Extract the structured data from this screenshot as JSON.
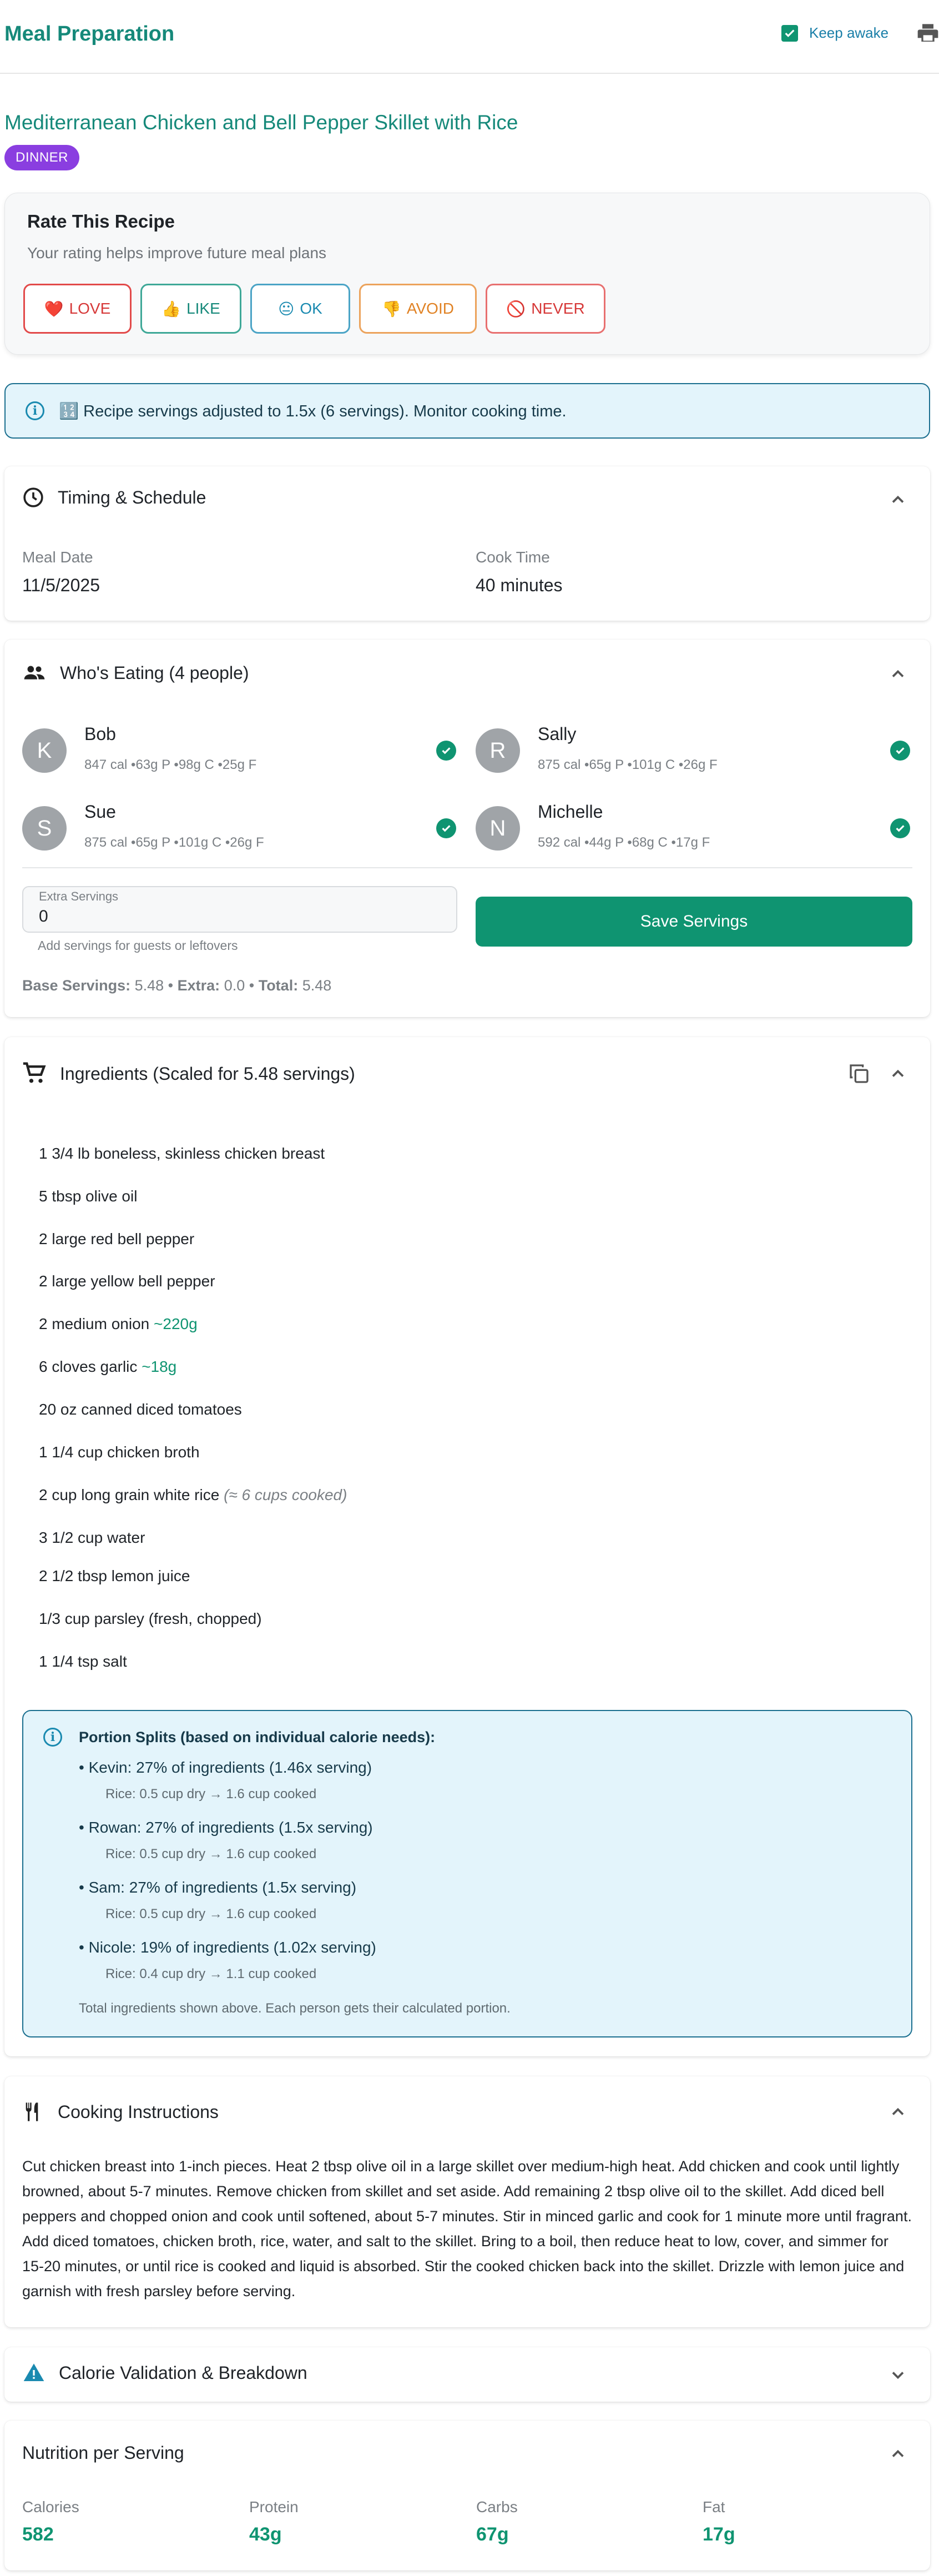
{
  "header": {
    "app_title": "Meal Preparation",
    "keep_awake_label": "Keep awake",
    "keep_awake_checked": true
  },
  "recipe": {
    "title": "Mediterranean Chicken and Bell Pepper Skillet with Rice",
    "meal_type_badge": "DINNER"
  },
  "rating": {
    "title": "Rate This Recipe",
    "subtitle": "Your rating helps improve future meal plans",
    "buttons": [
      {
        "label": "LOVE",
        "icon": "heart-icon",
        "emoji": "❤️",
        "color": "#e24a4a"
      },
      {
        "label": "LIKE",
        "icon": "thumbs-up-icon",
        "emoji": "👍",
        "color": "#16897a"
      },
      {
        "label": "OK",
        "icon": "neutral-face-icon",
        "emoji": "😐",
        "color": "#1a8ab0"
      },
      {
        "label": "AVOID",
        "icon": "thumbs-down-icon",
        "emoji": "👎",
        "color": "#e8892b"
      },
      {
        "label": "NEVER",
        "icon": "prohibited-icon",
        "emoji": "🚫",
        "color": "#e24a4a"
      }
    ]
  },
  "info_banner": {
    "icon": "info-icon",
    "text": "🔢 Recipe servings adjusted to 1.5x (6 servings). Monitor cooking time."
  },
  "timing": {
    "title": "Timing & Schedule",
    "meal_date_label": "Meal Date",
    "meal_date": "11/5/2025",
    "cook_time_label": "Cook Time",
    "cook_time": "40 minutes"
  },
  "eaters": {
    "title": "Who's Eating (4 people)",
    "people": [
      {
        "initial": "K",
        "name": "Bob",
        "macros": "847 cal •63g P •98g C •25g F"
      },
      {
        "initial": "R",
        "name": "Sally",
        "macros": "875 cal •65g P •101g C •26g F"
      },
      {
        "initial": "S",
        "name": "Sue",
        "macros": "875 cal •65g P •101g C •26g F"
      },
      {
        "initial": "N",
        "name": "Michelle",
        "macros": "592 cal •44g P •68g C •17g F"
      }
    ],
    "extra_label": "Extra Servings",
    "extra_value": "0",
    "extra_helper": "Add servings for guests or leftovers",
    "save_button": "Save Servings",
    "summary": {
      "base_label": "Base Servings:",
      "base_value": "5.48",
      "extra_label": "Extra:",
      "extra_value": "0.0",
      "total_label": "Total:",
      "total_value": "5.48"
    }
  },
  "ingredients": {
    "title": "Ingredients (Scaled for 5.48 servings)",
    "items": [
      {
        "text": "1 3/4 lb boneless, skinless chicken breast",
        "extra": "",
        "note": ""
      },
      {
        "text": "5 tbsp olive oil",
        "extra": "",
        "note": ""
      },
      {
        "text": "2 large red bell pepper",
        "extra": "",
        "note": ""
      },
      {
        "text": "2 large yellow bell pepper",
        "extra": "",
        "note": ""
      },
      {
        "text": "2 medium onion",
        "extra": "~220g",
        "note": ""
      },
      {
        "text": "6 cloves garlic",
        "extra": "~18g",
        "note": ""
      },
      {
        "text": "20 oz canned diced tomatoes",
        "extra": "",
        "note": ""
      },
      {
        "text": "1 1/4 cup chicken broth",
        "extra": "",
        "note": ""
      },
      {
        "text": "2 cup long grain white rice",
        "extra": "",
        "note": "(≈ 6 cups cooked)"
      },
      {
        "text": "3 1/2 cup water",
        "extra": "",
        "note": ""
      },
      {
        "text": "2 1/2 tbsp lemon juice",
        "extra": "",
        "note": ""
      },
      {
        "text": "1/3 cup parsley (fresh, chopped)",
        "extra": "",
        "note": ""
      },
      {
        "text": "1 1/4 tsp salt",
        "extra": "",
        "note": ""
      }
    ],
    "portion_splits": {
      "title": "Portion Splits (based on individual calorie needs):",
      "people": [
        {
          "line": "• Kevin: 27% of ingredients (1.46x serving)",
          "rice": "Rice: 0.5 cup dry → 1.6 cup cooked"
        },
        {
          "line": "• Rowan: 27% of ingredients (1.5x serving)",
          "rice": "Rice: 0.5 cup dry → 1.6 cup cooked"
        },
        {
          "line": "• Sam: 27% of ingredients (1.5x serving)",
          "rice": "Rice: 0.5 cup dry → 1.6 cup cooked"
        },
        {
          "line": "• Nicole: 19% of ingredients (1.02x serving)",
          "rice": "Rice: 0.4 cup dry → 1.1 cup cooked"
        }
      ],
      "footer": "Total ingredients shown above. Each person gets their calculated portion."
    }
  },
  "instructions": {
    "title": "Cooking Instructions",
    "text": "Cut chicken breast into 1-inch pieces. Heat 2 tbsp olive oil in a large skillet over medium-high heat. Add chicken and cook until lightly browned, about 5-7 minutes. Remove chicken from skillet and set aside. Add remaining 2 tbsp olive oil to the skillet. Add diced bell peppers and chopped onion and cook until softened, about 5-7 minutes. Stir in minced garlic and cook for 1 minute more until fragrant. Add diced tomatoes, chicken broth, rice, water, and salt to the skillet. Bring to a boil, then reduce heat to low, cover, and simmer for 15-20 minutes, or until rice is cooked and liquid is absorbed. Stir the cooked chicken back into the skillet. Drizzle with lemon juice and garnish with fresh parsley before serving."
  },
  "calorie_validation": {
    "title": "Calorie Validation & Breakdown",
    "icon": "warning-icon"
  },
  "nutrition": {
    "title": "Nutrition per Serving",
    "items": [
      {
        "label": "Calories",
        "value": "582"
      },
      {
        "label": "Protein",
        "value": "43g"
      },
      {
        "label": "Carbs",
        "value": "67g"
      },
      {
        "label": "Fat",
        "value": "17g"
      }
    ]
  },
  "colors": {
    "brand": "#16897a",
    "primary_button": "#0f9471",
    "badge": "#8a3ee0",
    "info_bg": "#e3f4fb",
    "info_border": "#1b6f8f"
  }
}
